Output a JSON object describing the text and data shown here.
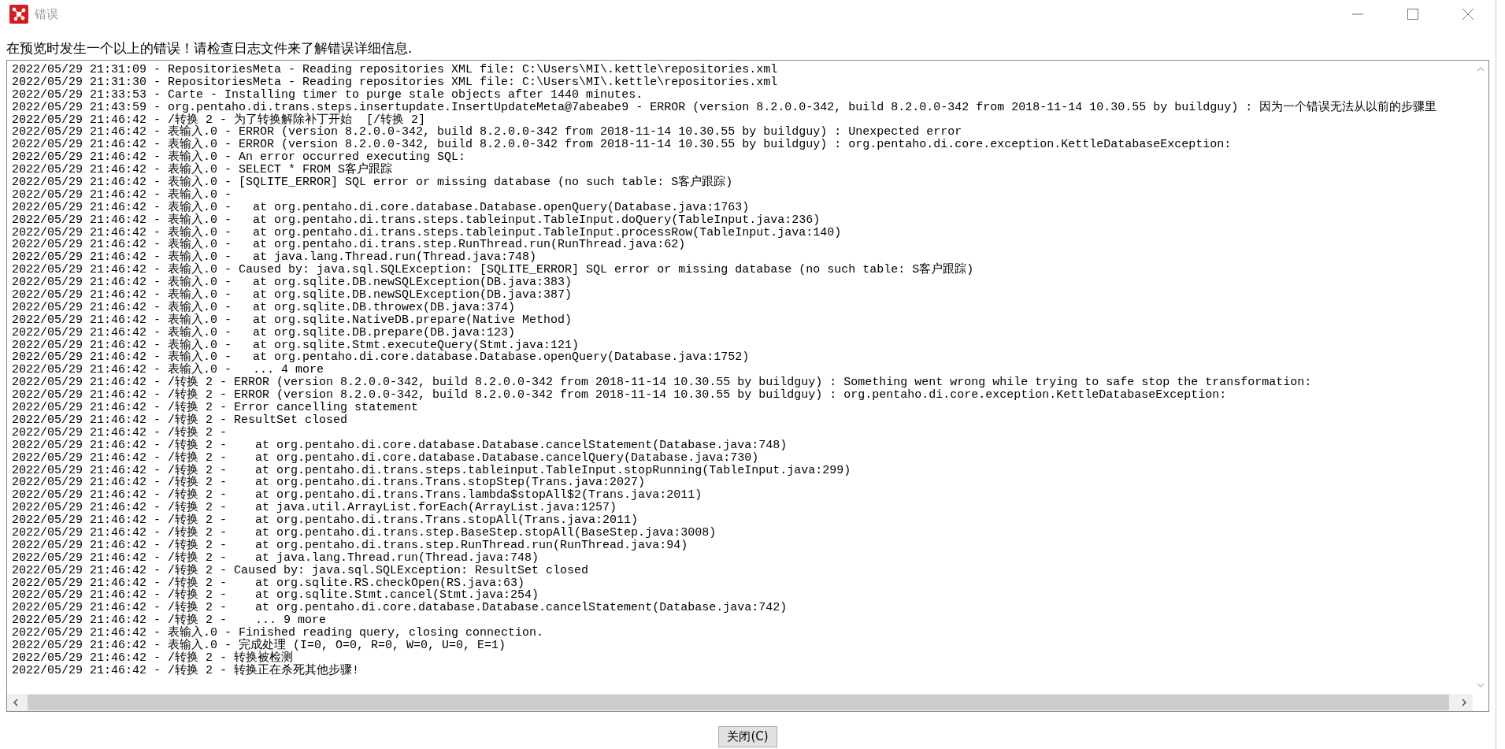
{
  "window": {
    "title": "错误"
  },
  "message": "在预览时发生一个以上的错误！请检查日志文件来了解错误详细信息.",
  "log": {
    "lines": [
      "2022/05/29 21:31:09 - RepositoriesMeta - Reading repositories XML file: C:\\Users\\MI\\.kettle\\repositories.xml",
      "2022/05/29 21:31:30 - RepositoriesMeta - Reading repositories XML file: C:\\Users\\MI\\.kettle\\repositories.xml",
      "2022/05/29 21:33:53 - Carte - Installing timer to purge stale objects after 1440 minutes.",
      "2022/05/29 21:43:59 - org.pentaho.di.trans.steps.insertupdate.InsertUpdateMeta@7abeabe9 - ERROR (version 8.2.0.0-342, build 8.2.0.0-342 from 2018-11-14 10.30.55 by buildguy) : 因为一个错误无法从以前的步骤里",
      "2022/05/29 21:46:42 - /转换 2 - 为了转换解除补丁开始  [/转换 2]",
      "2022/05/29 21:46:42 - 表输入.0 - ERROR (version 8.2.0.0-342, build 8.2.0.0-342 from 2018-11-14 10.30.55 by buildguy) : Unexpected error",
      "2022/05/29 21:46:42 - 表输入.0 - ERROR (version 8.2.0.0-342, build 8.2.0.0-342 from 2018-11-14 10.30.55 by buildguy) : org.pentaho.di.core.exception.KettleDatabaseException:",
      "2022/05/29 21:46:42 - 表输入.0 - An error occurred executing SQL:",
      "2022/05/29 21:46:42 - 表输入.0 - SELECT * FROM S客户跟踪",
      "2022/05/29 21:46:42 - 表输入.0 - [SQLITE_ERROR] SQL error or missing database (no such table: S客户跟踪)",
      "2022/05/29 21:46:42 - 表输入.0 -",
      "2022/05/29 21:46:42 - 表输入.0 -   at org.pentaho.di.core.database.Database.openQuery(Database.java:1763)",
      "2022/05/29 21:46:42 - 表输入.0 -   at org.pentaho.di.trans.steps.tableinput.TableInput.doQuery(TableInput.java:236)",
      "2022/05/29 21:46:42 - 表输入.0 -   at org.pentaho.di.trans.steps.tableinput.TableInput.processRow(TableInput.java:140)",
      "2022/05/29 21:46:42 - 表输入.0 -   at org.pentaho.di.trans.step.RunThread.run(RunThread.java:62)",
      "2022/05/29 21:46:42 - 表输入.0 -   at java.lang.Thread.run(Thread.java:748)",
      "2022/05/29 21:46:42 - 表输入.0 - Caused by: java.sql.SQLException: [SQLITE_ERROR] SQL error or missing database (no such table: S客户跟踪)",
      "2022/05/29 21:46:42 - 表输入.0 -   at org.sqlite.DB.newSQLException(DB.java:383)",
      "2022/05/29 21:46:42 - 表输入.0 -   at org.sqlite.DB.newSQLException(DB.java:387)",
      "2022/05/29 21:46:42 - 表输入.0 -   at org.sqlite.DB.throwex(DB.java:374)",
      "2022/05/29 21:46:42 - 表输入.0 -   at org.sqlite.NativeDB.prepare(Native Method)",
      "2022/05/29 21:46:42 - 表输入.0 -   at org.sqlite.DB.prepare(DB.java:123)",
      "2022/05/29 21:46:42 - 表输入.0 -   at org.sqlite.Stmt.executeQuery(Stmt.java:121)",
      "2022/05/29 21:46:42 - 表输入.0 -   at org.pentaho.di.core.database.Database.openQuery(Database.java:1752)",
      "2022/05/29 21:46:42 - 表输入.0 -   ... 4 more",
      "2022/05/29 21:46:42 - /转换 2 - ERROR (version 8.2.0.0-342, build 8.2.0.0-342 from 2018-11-14 10.30.55 by buildguy) : Something went wrong while trying to safe stop the transformation:",
      "2022/05/29 21:46:42 - /转换 2 - ERROR (version 8.2.0.0-342, build 8.2.0.0-342 from 2018-11-14 10.30.55 by buildguy) : org.pentaho.di.core.exception.KettleDatabaseException:",
      "2022/05/29 21:46:42 - /转换 2 - Error cancelling statement",
      "2022/05/29 21:46:42 - /转换 2 - ResultSet closed",
      "2022/05/29 21:46:42 - /转换 2 -",
      "2022/05/29 21:46:42 - /转换 2 -    at org.pentaho.di.core.database.Database.cancelStatement(Database.java:748)",
      "2022/05/29 21:46:42 - /转换 2 -    at org.pentaho.di.core.database.Database.cancelQuery(Database.java:730)",
      "2022/05/29 21:46:42 - /转换 2 -    at org.pentaho.di.trans.steps.tableinput.TableInput.stopRunning(TableInput.java:299)",
      "2022/05/29 21:46:42 - /转换 2 -    at org.pentaho.di.trans.Trans.stopStep(Trans.java:2027)",
      "2022/05/29 21:46:42 - /转换 2 -    at org.pentaho.di.trans.Trans.lambda$stopAll$2(Trans.java:2011)",
      "2022/05/29 21:46:42 - /转换 2 -    at java.util.ArrayList.forEach(ArrayList.java:1257)",
      "2022/05/29 21:46:42 - /转换 2 -    at org.pentaho.di.trans.Trans.stopAll(Trans.java:2011)",
      "2022/05/29 21:46:42 - /转换 2 -    at org.pentaho.di.trans.step.BaseStep.stopAll(BaseStep.java:3008)",
      "2022/05/29 21:46:42 - /转换 2 -    at org.pentaho.di.trans.step.RunThread.run(RunThread.java:94)",
      "2022/05/29 21:46:42 - /转换 2 -    at java.lang.Thread.run(Thread.java:748)",
      "2022/05/29 21:46:42 - /转换 2 - Caused by: java.sql.SQLException: ResultSet closed",
      "2022/05/29 21:46:42 - /转换 2 -    at org.sqlite.RS.checkOpen(RS.java:63)",
      "2022/05/29 21:46:42 - /转换 2 -    at org.sqlite.Stmt.cancel(Stmt.java:254)",
      "2022/05/29 21:46:42 - /转换 2 -    at org.pentaho.di.core.database.Database.cancelStatement(Database.java:742)",
      "2022/05/29 21:46:42 - /转换 2 -    ... 9 more",
      "2022/05/29 21:46:42 - 表输入.0 - Finished reading query, closing connection.",
      "2022/05/29 21:46:42 - 表输入.0 - 完成处理 (I=0, O=0, R=0, W=0, U=0, E=1)",
      "2022/05/29 21:46:42 - /转换 2 - 转换被检测",
      "2022/05/29 21:46:42 - /转换 2 - 转换正在杀死其他步骤!"
    ]
  },
  "buttons": [
    {
      "label": "关闭(C)"
    }
  ]
}
